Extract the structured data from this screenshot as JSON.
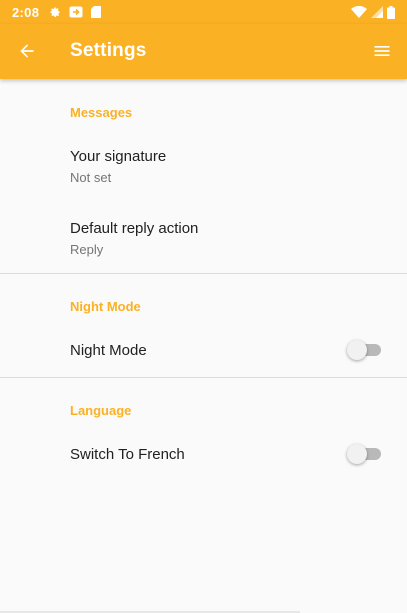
{
  "status_bar": {
    "time": "2:08",
    "left_icons": [
      "settings-gear-icon",
      "sync-badge-icon",
      "sd-card-icon"
    ],
    "right_icons": [
      "wifi-icon",
      "signal-icon",
      "battery-icon"
    ]
  },
  "app_bar": {
    "title": "Settings",
    "back_icon": "arrow-left-icon",
    "menu_icon": "hamburger-menu-icon",
    "color": "#fbb124"
  },
  "sections": {
    "messages": {
      "header": "Messages",
      "signature": {
        "title": "Your signature",
        "summary": "Not set"
      },
      "reply_action": {
        "title": "Default reply action",
        "summary": "Reply"
      }
    },
    "night_mode": {
      "header": "Night Mode",
      "toggle": {
        "title": "Night Mode",
        "enabled": false
      }
    },
    "language": {
      "header": "Language",
      "toggle": {
        "title": "Switch To French",
        "enabled": false
      }
    }
  },
  "colors": {
    "accent": "#fbb124",
    "background": "#fafafa",
    "primary_text": "#212121",
    "secondary_text": "#757575",
    "divider": "#dcdcdc"
  }
}
